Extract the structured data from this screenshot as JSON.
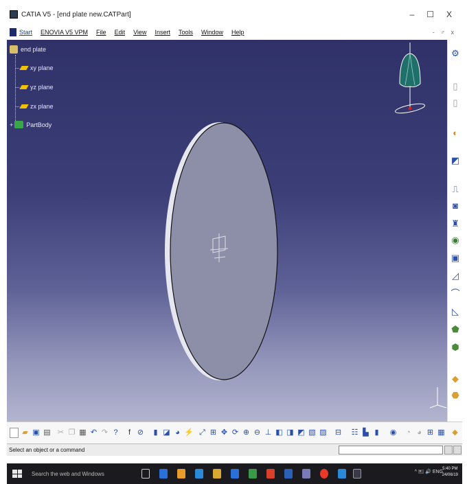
{
  "window": {
    "title": "CATIA V5 - [end plate new.CATPart]",
    "controls": [
      "–",
      "☐",
      "X"
    ]
  },
  "menubar": {
    "items": [
      "Start",
      "ENOVIA V5 VPM",
      "File",
      "Edit",
      "View",
      "Insert",
      "Tools",
      "Window",
      "Help"
    ],
    "restore": "- ♂ x"
  },
  "tree": {
    "root": "end plate",
    "planes": [
      "xy plane",
      "yz plane",
      "zx plane"
    ],
    "body": "PartBody"
  },
  "statusbar": {
    "text": "Select an object or a command",
    "command_value": ""
  },
  "taskbar": {
    "search_placeholder": "Search the web and Windows",
    "tray": "^ 🖭 🔊 ENG",
    "clock_time": "5:40 PM",
    "clock_date": "24/06/19"
  },
  "colors": {
    "viewport_top": "#2f3168",
    "viewport_bottom": "#b3b4cf",
    "disc_fill": "#8d8ea8",
    "plane_icon": "#f2c200",
    "partbody_icon": "#3aa64a"
  }
}
